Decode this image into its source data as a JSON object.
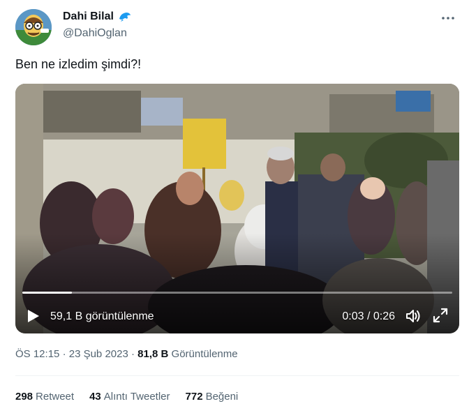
{
  "author": {
    "display_name": "Dahi Bilal",
    "handle": "@DahiOglan",
    "badge_icon": "dolphin-icon"
  },
  "more_icon": "more-horizontal-icon",
  "tweet": {
    "text": "Ben ne izledim şimdi?!"
  },
  "video": {
    "views_label": "59,1 B görüntülenme",
    "time_label": "0:03 / 0:26",
    "progress": 0.115,
    "play_icon": "play-icon",
    "volume_icon": "volume-icon",
    "fullscreen_icon": "fullscreen-icon"
  },
  "meta": {
    "time": "ÖS 12:15",
    "sep1": "·",
    "date": "23 Şub 2023",
    "sep2": "·",
    "views_count": "81,8 B",
    "views_label": "Görüntülenme"
  },
  "stats": {
    "retweets_count": "298",
    "retweets_label": "Retweet",
    "quotes_count": "43",
    "quotes_label": "Alıntı Tweetler",
    "likes_count": "772",
    "likes_label": "Beğeni"
  },
  "colors": {
    "text_primary": "#0f1419",
    "text_secondary": "#536471",
    "badge_blue": "#1d9bf0",
    "divider": "#eff3f4"
  }
}
